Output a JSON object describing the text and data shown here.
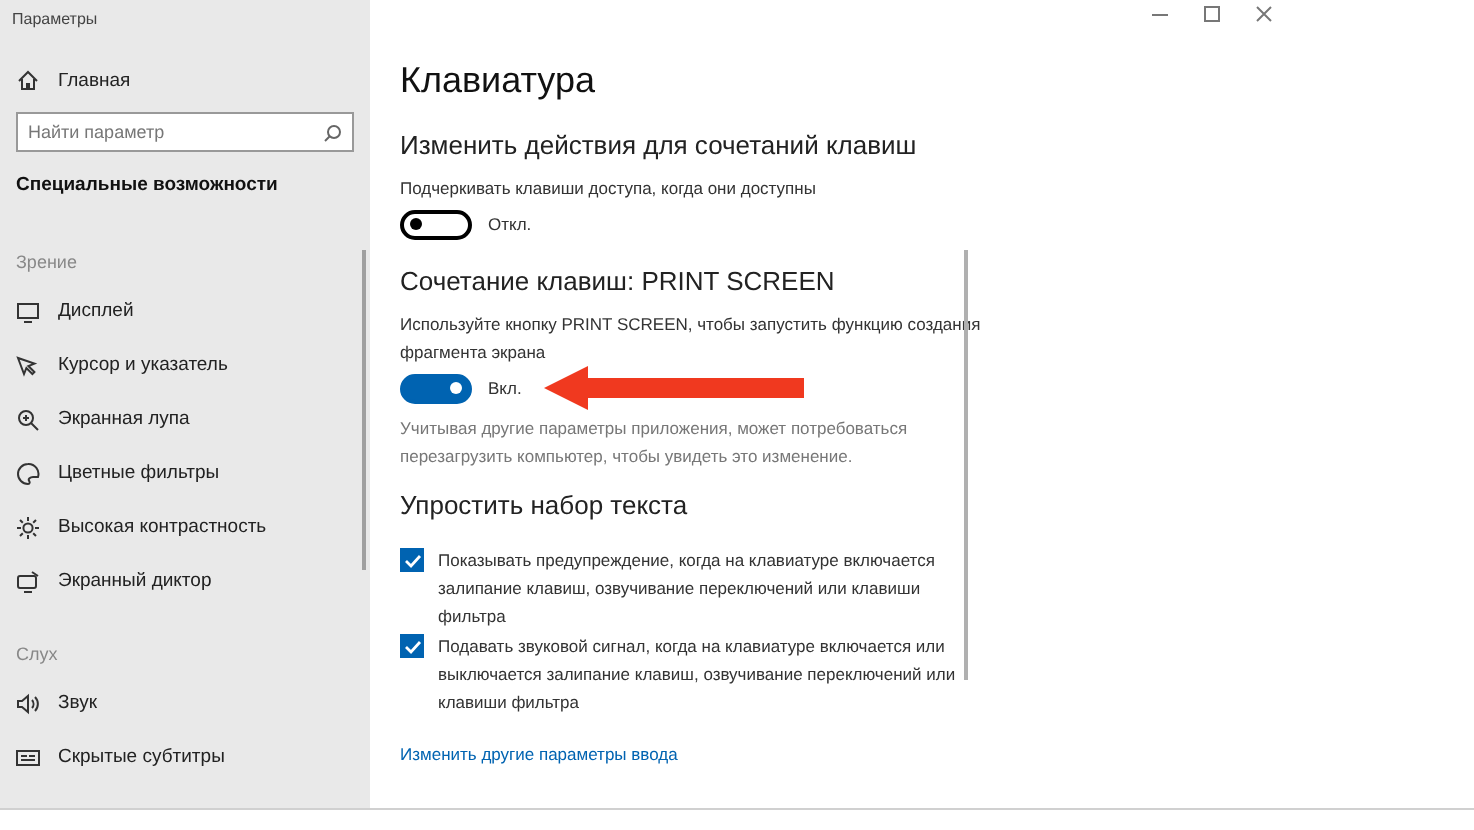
{
  "window": {
    "title": "Параметры"
  },
  "sidebar": {
    "home": {
      "label": "Главная"
    },
    "search": {
      "placeholder": "Найти параметр"
    },
    "section": "Специальные возможности",
    "groups": [
      {
        "label": "Зрение",
        "items": [
          {
            "label": "Дисплей"
          },
          {
            "label": "Курсор и указатель"
          },
          {
            "label": "Экранная лупа"
          },
          {
            "label": "Цветные фильтры"
          },
          {
            "label": "Высокая контрастность"
          },
          {
            "label": "Экранный диктор"
          }
        ]
      },
      {
        "label": "Слух",
        "items": [
          {
            "label": "Звук"
          },
          {
            "label": "Скрытые субтитры"
          }
        ]
      }
    ]
  },
  "page": {
    "title": "Клавиатура",
    "sections": [
      {
        "heading": "Изменить действия для сочетаний клавиш",
        "items": [
          {
            "kind": "toggle",
            "label": "Подчеркивать клавиши доступа, когда они доступны",
            "on": false,
            "state": "Откл."
          }
        ]
      },
      {
        "heading": "Сочетание клавиш: PRINT SCREEN",
        "items": [
          {
            "kind": "toggle",
            "label": "Используйте кнопку PRINT SCREEN, чтобы запустить функцию создания фрагмента экрана",
            "on": true,
            "state": "Вкл."
          },
          {
            "kind": "note",
            "text": "Учитывая другие параметры приложения, может потребоваться перезагрузить компьютер, чтобы увидеть это изменение."
          }
        ]
      },
      {
        "heading": "Упростить набор текста",
        "items": [
          {
            "kind": "checkbox",
            "label": "Показывать предупреждение, когда на клавиатуре включается залипание клавиш, озвучивание переключений или клавиши фильтра",
            "checked": true
          },
          {
            "kind": "checkbox",
            "label": "Подавать звуковой сигнал, когда на клавиатуре включается или выключается залипание клавиш, озвучивание переключений или клавиши фильтра",
            "checked": true
          },
          {
            "kind": "link",
            "text": "Изменить другие параметры ввода"
          }
        ]
      }
    ]
  }
}
